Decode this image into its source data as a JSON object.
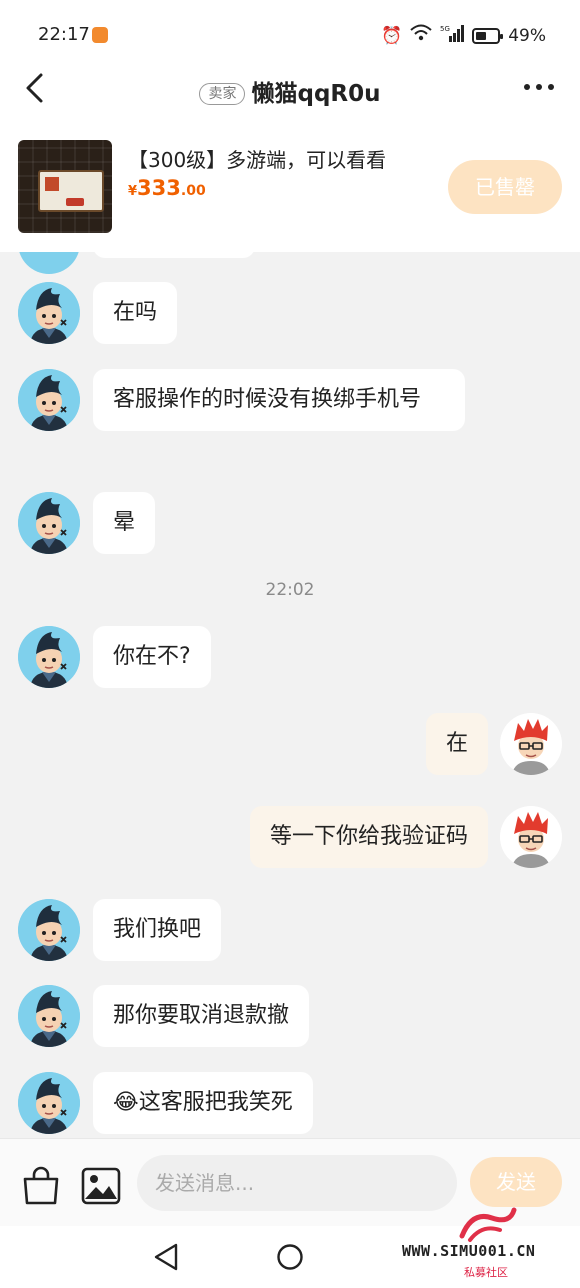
{
  "status_bar": {
    "time": "22:17",
    "network": "5G",
    "battery": "49%",
    "battery_level": 0.49
  },
  "header": {
    "seller_tag": "卖家",
    "title": "懒猫qqR0u"
  },
  "product": {
    "title": "【300级】多游端，可以看看",
    "price_currency": "¥",
    "price_integer": "333",
    "price_decimal": ".00",
    "status_button": "已售罄"
  },
  "messages": [
    {
      "from": "seller",
      "text": "在吗"
    },
    {
      "from": "seller",
      "text": "客服操作的时候没有换绑手机号"
    },
    {
      "from": "seller",
      "text": "晕"
    },
    {
      "from": "time",
      "text": "22:02"
    },
    {
      "from": "seller",
      "text": "你在不?"
    },
    {
      "from": "me",
      "text": "在"
    },
    {
      "from": "me",
      "text": "等一下你给我验证码"
    },
    {
      "from": "seller",
      "text": "我们换吧"
    },
    {
      "from": "seller",
      "text": "那你要取消退款撤"
    },
    {
      "from": "seller",
      "text": "😂这客服把我笑死"
    }
  ],
  "input_bar": {
    "placeholder": "发送消息...",
    "send_label": "发送"
  },
  "watermark": {
    "text": "WWW.SIMU001.CN",
    "subtext": "私募社区"
  },
  "colors": {
    "accent_orange": "#f06000",
    "sold_button_bg": "#fde3c2",
    "my_bubble_bg": "#fbf4ea",
    "chat_bg": "#f2f2f2"
  }
}
